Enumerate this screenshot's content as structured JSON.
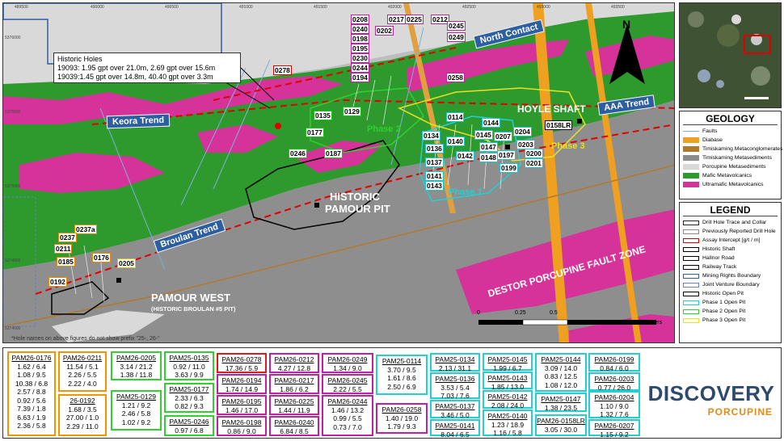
{
  "map": {
    "x_ticks": [
      "489500",
      "490000",
      "490500",
      "491000",
      "491500",
      "492000",
      "492500",
      "493000",
      "493500"
    ],
    "y_ticks": [
      "5376000",
      "5375500",
      "5375000",
      "5374500",
      "5374000"
    ],
    "historic_holes": {
      "title": "Historic Holes",
      "line1": "19093: 1.95 gpt over 21.0m,  2.69 gpt over 15.6m",
      "line2": "19039:1.45 gpt over 14.8m, 40.40 gpt over 3.3m"
    },
    "trends": {
      "keora": "Keora Trend",
      "broulan": "Broulan Trend",
      "north_contact": "North Contact",
      "aaa": "AAA Trend"
    },
    "places": {
      "historic_pamour_1": "HISTORIC",
      "historic_pamour_2": "PAMOUR PIT",
      "pamour_west": "PAMOUR WEST",
      "broulan_pit": "(HISTORIC BROULAN #5 PIT)",
      "hoyle_shaft": "HOYLE SHAFT",
      "destor": "DESTOR PORCUPINE FAULT ZONE"
    },
    "phases": {
      "p1": "Phase 1",
      "p2": "Phase 2",
      "p3": "Phase 3"
    },
    "scale": {
      "s0": "0",
      "s1": "0.25",
      "s2": "0.5",
      "unit": "Kilometers"
    },
    "north": "N",
    "note": "*Hole names on above figures do not show prefix \"25-, 26-\"",
    "holes": {
      "h0278": "0278",
      "h0208": "0208",
      "h0240": "0240",
      "h0198": "0198",
      "h0195": "0195",
      "h0230": "0230",
      "h0244": "0244",
      "h0194": "0194",
      "h0217": "0217",
      "h0225": "0225",
      "h0202": "0202",
      "h0212": "0212",
      "h0245": "0245",
      "h0249": "0249",
      "h0258": "0258",
      "h0135": "0135",
      "h0129": "0129",
      "h0177": "0177",
      "h0246": "0246",
      "h0187": "0187",
      "h0114": "0114",
      "h0144": "0144",
      "h0134": "0134",
      "h0145": "0145",
      "h0207": "0207",
      "h0204": "0204",
      "h0140": "0140",
      "h0136": "0136",
      "h0147": "0147",
      "h0203": "0203",
      "h0142": "0142",
      "h0148": "0148",
      "h0197": "0197",
      "h0200": "0200",
      "h0137": "0137",
      "h0201": "0201",
      "h0199": "0199",
      "h0141": "0141",
      "h0143": "0143",
      "h0158LR": "0158LR",
      "h0237a": "0237a",
      "h0237": "0237",
      "h0211": "0211",
      "h0185": "0185",
      "h0176": "0176",
      "h0205": "0205",
      "h0192": "0192"
    }
  },
  "geology": {
    "title": "GEOLOGY",
    "items": [
      {
        "label": "Faults",
        "color": "#7fb0d8",
        "kind": "line"
      },
      {
        "label": "Diabase",
        "color": "#f0a020",
        "kind": "box"
      },
      {
        "label": "Timiskaming Metaconglomerates",
        "color": "#b07a2a",
        "kind": "box"
      },
      {
        "label": "Timiskaming Metasediments",
        "color": "#8c8c8c",
        "kind": "box"
      },
      {
        "label": "Porcupine Metasediments",
        "color": "#d8d8d8",
        "kind": "box"
      },
      {
        "label": "Mafic Metavolcanics",
        "color": "#2d9a2d",
        "kind": "box"
      },
      {
        "label": "Ultramafic Metavolcanics",
        "color": "#d6339a",
        "kind": "box"
      }
    ]
  },
  "legend": {
    "title": "LEGEND",
    "items": [
      {
        "label": "Drill Hole Trace and Collar",
        "color": "#222222"
      },
      {
        "label": "Previously Reported Drill Hole",
        "color": "#888888"
      },
      {
        "label": "Assay Intercept [g/t / m]",
        "color": "#e00000"
      },
      {
        "label": "Historic Shaft",
        "color": "#000000"
      },
      {
        "label": "Hallnor Road",
        "color": "#000000"
      },
      {
        "label": "Railway Track",
        "color": "#000000"
      },
      {
        "label": "Mining Rights Boundary",
        "color": "#2d5fa0"
      },
      {
        "label": "Joint Venture Boundary",
        "color": "#6a7fc0"
      },
      {
        "label": "Historic Open Pit",
        "color": "#000000"
      },
      {
        "label": "Phase 1 Open Pit",
        "color": "#22d0d4"
      },
      {
        "label": "Phase 2 Open Pit",
        "color": "#2fd02f"
      },
      {
        "label": "Phase 3 Open Pit",
        "color": "#e8e020"
      }
    ]
  },
  "results": [
    {
      "title": "PAM26-0176",
      "lines": [
        "1.62 / 6.4",
        "1.08 / 9.5",
        "10.38 / 6.8",
        "2.57 / 8.8",
        "0.92 / 5.6",
        "7.39 / 1.8",
        "6.63 / 1.9",
        "2.36 / 5.8"
      ]
    },
    {
      "title": "PAM26-0211",
      "lines": [
        "11.54 / 5.1",
        "2.26 / 5.5",
        "2.22 / 4.0"
      ]
    },
    {
      "title": "26-0192",
      "lines": [
        "1.68 / 3.5",
        "27.00 / 1.0",
        "2.29 / 11.0"
      ]
    },
    {
      "title": "PAM26-0205",
      "lines": [
        "3.14 / 21.2",
        "1.38 / 11.8"
      ]
    },
    {
      "title": "PAM25-0129",
      "lines": [
        "1.21 / 9.2",
        "2.46 / 5.8",
        "1.02 / 9.2"
      ]
    },
    {
      "title": "PAM25-0135",
      "lines": [
        "0.92 / 11.0",
        "3.63 / 9.9"
      ]
    },
    {
      "title": "PAM25-0177",
      "lines": [
        "2.33 / 6.3",
        "0.82 / 9.3"
      ]
    },
    {
      "title": "PAM25-0246",
      "lines": [
        "0.97 / 6.8"
      ]
    },
    {
      "title": "PAM26-0278",
      "lines": [
        "17.36 / 5.9"
      ]
    },
    {
      "title": "PAM26-0194",
      "lines": [
        "1.74 / 14.9"
      ]
    },
    {
      "title": "PAM26-0195",
      "lines": [
        "1.46 / 17.0"
      ]
    },
    {
      "title": "PAM26-0198",
      "lines": [
        "0.86 / 9.0"
      ]
    },
    {
      "title": "PAM26-0212",
      "lines": [
        "4.27 / 12.8"
      ]
    },
    {
      "title": "PAM26-0217",
      "lines": [
        "1.86 / 6.2"
      ]
    },
    {
      "title": "PAM26-0225",
      "lines": [
        "1.44 / 11.9"
      ]
    },
    {
      "title": "PAM26-0240",
      "lines": [
        "6.84 / 8.5"
      ]
    },
    {
      "title": "PAM26-0249",
      "lines": [
        "1.34 / 9.0"
      ]
    },
    {
      "title": "PAM26-0245",
      "lines": [
        "2.22 / 5.5"
      ]
    },
    {
      "title": "PAM26-0244",
      "lines": [
        "1.46 / 13.2",
        "0.99 / 5.5",
        "0.73 / 7.0"
      ]
    },
    {
      "title": "PAM25-0114",
      "lines": [
        "3.70 / 9.5",
        "1.61 / 8.6",
        "2.50 / 6.9"
      ]
    },
    {
      "title": "PAM26-0258",
      "lines": [
        "1.40 / 19.0",
        "1.79 / 9.3"
      ]
    },
    {
      "title": "PAM25-0134",
      "lines": [
        "2.13 / 31.1"
      ]
    },
    {
      "title": "PAM25-0136",
      "lines": [
        "3.53 / 5.4",
        "7.03 / 7.6"
      ]
    },
    {
      "title": "PAM25-0137",
      "lines": [
        "3.46 / 5.0"
      ]
    },
    {
      "title": "PAM25-0141",
      "lines": [
        "8.04 / 6.5"
      ]
    },
    {
      "title": "PAM25-0145",
      "lines": [
        "1.99 / 6.7"
      ]
    },
    {
      "title": "PAM25-0143",
      "lines": [
        "1.85 / 13.0"
      ]
    },
    {
      "title": "PAM25-0142",
      "lines": [
        "2.08 / 24.0"
      ]
    },
    {
      "title": "PAM25-0140",
      "lines": [
        "1.23 / 18.9",
        "1.16 / 5.8"
      ]
    },
    {
      "title": "PAM25-0144",
      "lines": [
        "3.09 / 14.0",
        "0.83 / 12.5",
        "1.08 / 12.0"
      ]
    },
    {
      "title": "PAM25-0147",
      "lines": [
        "1.38 / 23.5"
      ]
    },
    {
      "title": "PAM26-0158LR",
      "lines": [
        "3.05 / 30.0"
      ]
    },
    {
      "title": "PAM26-0199",
      "lines": [
        "0.84 / 6.0"
      ]
    },
    {
      "title": "PAM26-0203",
      "lines": [
        "0.77 / 26.0"
      ]
    },
    {
      "title": "PAM26-0204",
      "lines": [
        "1.10 / 9.0",
        "1.32 / 7.6"
      ]
    },
    {
      "title": "PAM26-0207",
      "lines": [
        "1.15 / 9.2"
      ]
    }
  ],
  "logo": {
    "line1": "DISCOVERY",
    "line2": "PORCUPINE"
  }
}
